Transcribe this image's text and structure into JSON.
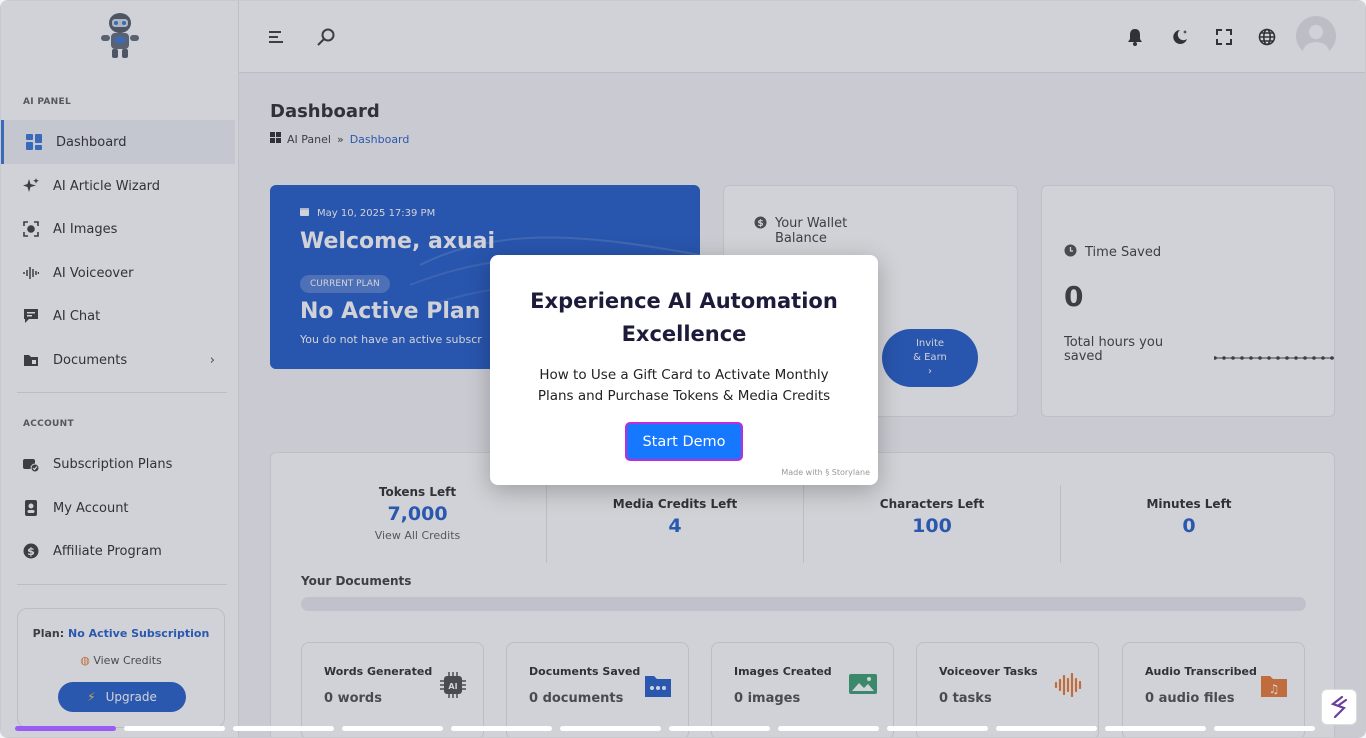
{
  "sidebar": {
    "section_ai": "AI PANEL",
    "section_account": "ACCOUNT",
    "items": [
      {
        "label": "Dashboard",
        "icon": "dashboard-icon"
      },
      {
        "label": "AI Article Wizard",
        "icon": "sparkle-icon"
      },
      {
        "label": "AI Images",
        "icon": "image-scan-icon"
      },
      {
        "label": "AI Voiceover",
        "icon": "waveform-icon"
      },
      {
        "label": "AI Chat",
        "icon": "chat-icon"
      },
      {
        "label": "Documents",
        "icon": "folder-icon"
      }
    ],
    "account_items": [
      {
        "label": "Subscription Plans",
        "icon": "wallet-check-icon"
      },
      {
        "label": "My Account",
        "icon": "contact-icon"
      },
      {
        "label": "Affiliate Program",
        "icon": "dollar-coin-icon"
      }
    ],
    "plan_prefix": "Plan:",
    "plan_value": "No Active Subscription",
    "view_credits": "View Credits",
    "upgrade": "Upgrade"
  },
  "header": {
    "icons": [
      "menu-icon",
      "search-icon",
      "bell-icon",
      "moon-icon",
      "fullscreen-icon",
      "globe-icon"
    ]
  },
  "main": {
    "title": "Dashboard",
    "breadcrumb_root": "AI Panel",
    "breadcrumb_sep": "»",
    "breadcrumb_current": "Dashboard",
    "welcome": {
      "date": "May 10, 2025 17:39 PM",
      "greeting": "Welcome, axuai",
      "badge": "CURRENT PLAN",
      "plan": "No Active Plan",
      "sub": "You do not have an active subscr"
    },
    "wallet": {
      "title_line1": "Your Wallet",
      "title_line2": "Balance",
      "invite_line1": "Invite",
      "invite_line2": "& Earn",
      "invite_arrow": "›"
    },
    "time": {
      "title": "Time Saved",
      "value": "0",
      "sub": "Total hours you saved"
    },
    "credits": [
      {
        "label": "Tokens Left",
        "value": "7,000",
        "link": "View All Credits"
      },
      {
        "label": "Media Credits Left",
        "value": "4"
      },
      {
        "label": "Characters Left",
        "value": "100"
      },
      {
        "label": "Minutes Left",
        "value": "0"
      }
    ],
    "documents_label": "Your Documents",
    "stats": [
      {
        "label": "Words Generated",
        "value": "0 words",
        "icon": "ai-chip-icon",
        "color": "#333333"
      },
      {
        "label": "Documents Saved",
        "value": "0 documents",
        "icon": "folder-dots-icon",
        "color": "#1a56c8"
      },
      {
        "label": "Images Created",
        "value": "0 images",
        "icon": "picture-icon",
        "color": "#2e9a6a"
      },
      {
        "label": "Voiceover Tasks",
        "value": "0 tasks",
        "icon": "audio-wave-icon",
        "color": "#e8722a"
      },
      {
        "label": "Audio Transcribed",
        "value": "0 audio files",
        "icon": "music-folder-icon",
        "color": "#e8722a"
      }
    ]
  },
  "modal": {
    "title_line1": "Experience AI Automation",
    "title_line2": "Excellence",
    "description": "How to Use a Gift Card to Activate Monthly Plans and Purchase Tokens & Media Credits",
    "cta": "Start Demo",
    "made_with": "Made with",
    "brand": "Storylane"
  },
  "demo_progress": {
    "segments": 12,
    "current": 1
  },
  "colors": {
    "accent": "#1a56c8",
    "cta": "#1677ff",
    "progress": "#9b5cf6"
  }
}
